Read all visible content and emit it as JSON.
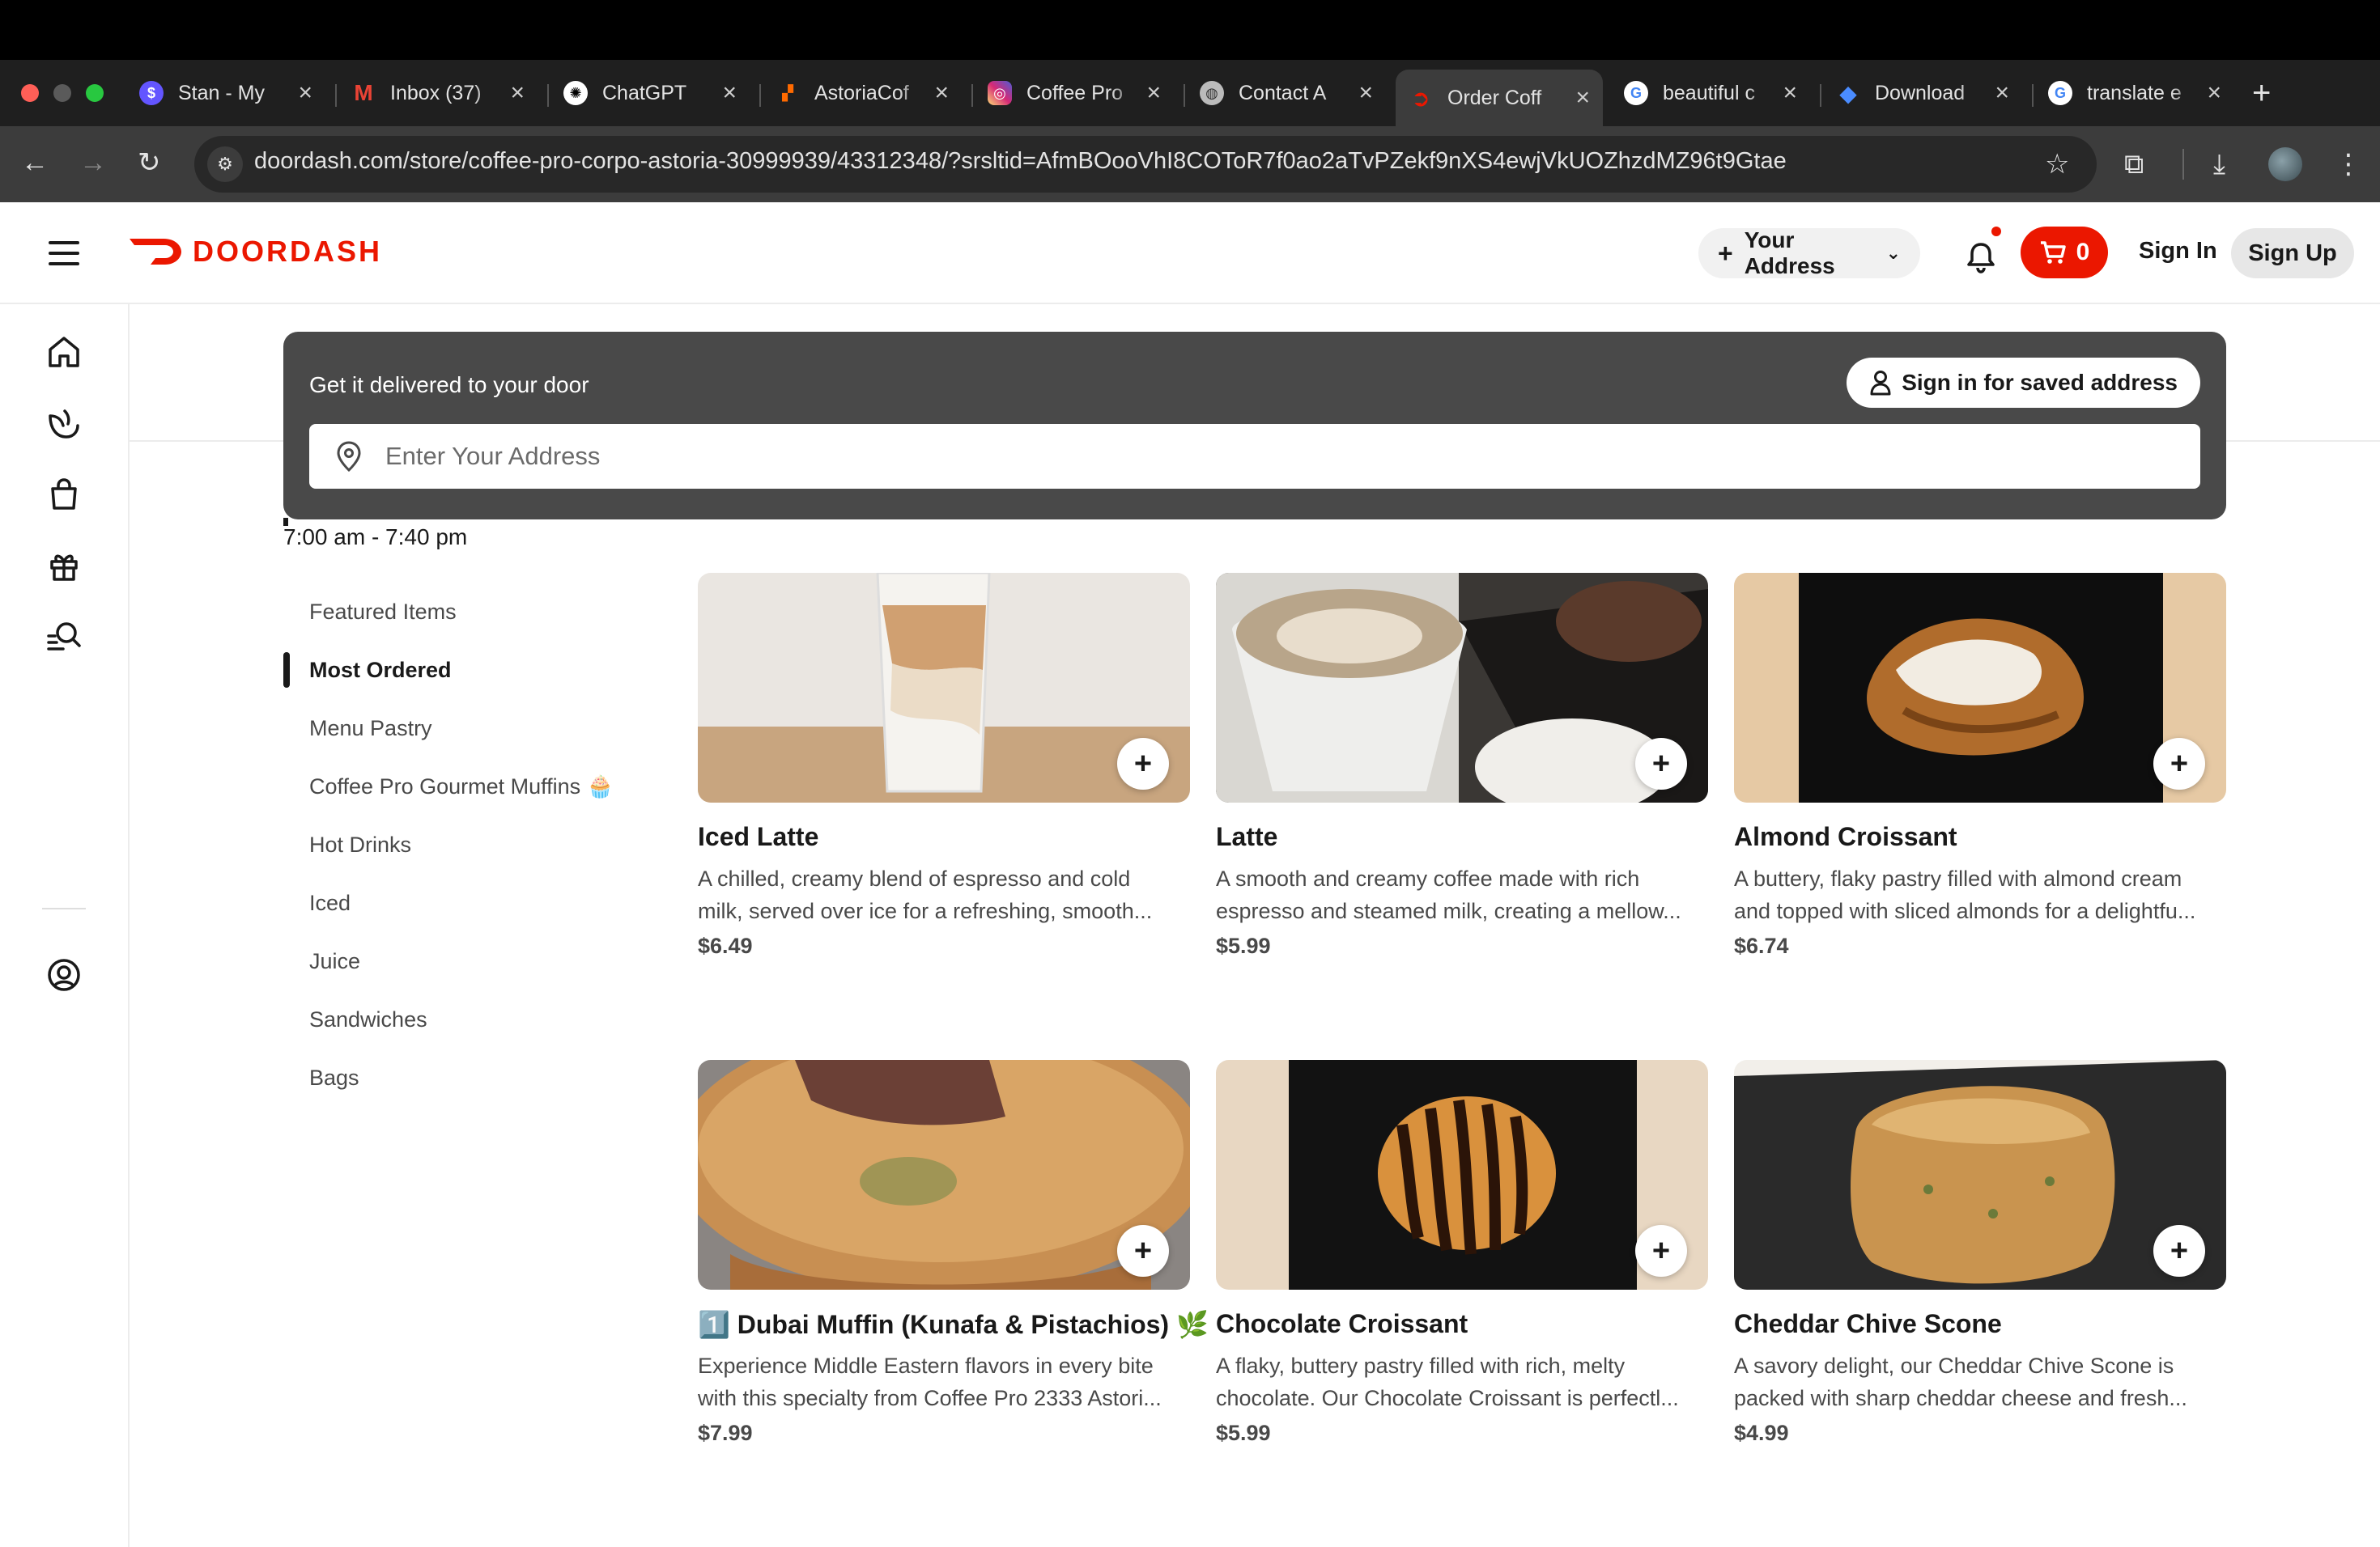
{
  "browser": {
    "tabs": [
      {
        "title": "Stan - My",
        "icon": "stan-favicon",
        "color": "#6355ff"
      },
      {
        "title": "Inbox (37)",
        "icon": "gmail-favicon",
        "color": "#ea4335"
      },
      {
        "title": "ChatGPT",
        "icon": "chatgpt-favicon",
        "color": "#ffffff"
      },
      {
        "title": "AstoriaCof",
        "icon": "astoria-favicon",
        "color": "#ff6a00"
      },
      {
        "title": "Coffee Pro",
        "icon": "instagram-favicon",
        "color": "#d62976"
      },
      {
        "title": "Contact A",
        "icon": "globe-favicon",
        "color": "#aaaaaa"
      },
      {
        "title": "Order Coff",
        "icon": "doordash-favicon",
        "color": "#eb1700",
        "active": true
      },
      {
        "title": "beautiful c",
        "icon": "google-favicon",
        "color": "#4285f4"
      },
      {
        "title": "Download",
        "icon": "gem-favicon",
        "color": "#4a8cff"
      },
      {
        "title": "translate e",
        "icon": "google-favicon",
        "color": "#4285f4"
      }
    ],
    "url": "doordash.com/store/coffee-pro-corpo-astoria-30999939/43312348/?srsltid=AfmBOooVhI8COToR7f0ao2aTvPZekf9nXS4ewjVkUOZhzdMZ96t9Gtae"
  },
  "header": {
    "brand": "DOORDASH",
    "brand_color": "#eb1700",
    "address_button": "Your Address",
    "cart_count": "0",
    "sign_in": "Sign In",
    "sign_up": "Sign Up"
  },
  "delivery": {
    "title": "Get it delivered to your door",
    "saved_address_button": "Sign in for saved address",
    "address_placeholder": "Enter Your Address"
  },
  "store": {
    "hours": "7:00 am - 7:40 pm"
  },
  "menu": {
    "categories": [
      {
        "label": "Featured Items"
      },
      {
        "label": "Most Ordered",
        "active": true
      },
      {
        "label": "Menu Pastry"
      },
      {
        "label": "Coffee Pro Gourmet Muffins 🧁"
      },
      {
        "label": "Hot Drinks"
      },
      {
        "label": "Iced"
      },
      {
        "label": "Juice"
      },
      {
        "label": "Sandwiches"
      },
      {
        "label": "Bags"
      }
    ]
  },
  "items": [
    {
      "name": "Iced Latte",
      "desc1": "A chilled, creamy blend of espresso and cold",
      "desc2": "milk, served over ice for a refreshing, smooth...",
      "price": "$6.49"
    },
    {
      "name": "Latte",
      "desc1": "A smooth and creamy coffee made with rich",
      "desc2": "espresso and steamed milk, creating a mellow...",
      "price": "$5.99"
    },
    {
      "name": "Almond Croissant",
      "desc1": "A buttery, flaky pastry filled with almond cream",
      "desc2": "and topped with sliced almonds for a delightfu...",
      "price": "$6.74"
    },
    {
      "name": "1️⃣ Dubai Muffin (Kunafa & Pistachios) 🌿",
      "desc1": "Experience Middle Eastern flavors in every bite",
      "desc2": "with this specialty from Coffee Pro 2333 Astori...",
      "price": "$7.99"
    },
    {
      "name": "Chocolate Croissant",
      "desc1": "A flaky, buttery pastry filled with rich, melty",
      "desc2": "chocolate. Our Chocolate Croissant is perfectl...",
      "price": "$5.99"
    },
    {
      "name": "Cheddar Chive Scone",
      "desc1": "A savory delight, our Cheddar Chive Scone is",
      "desc2": "packed with sharp cheddar cheese and fresh...",
      "price": "$4.99"
    }
  ]
}
